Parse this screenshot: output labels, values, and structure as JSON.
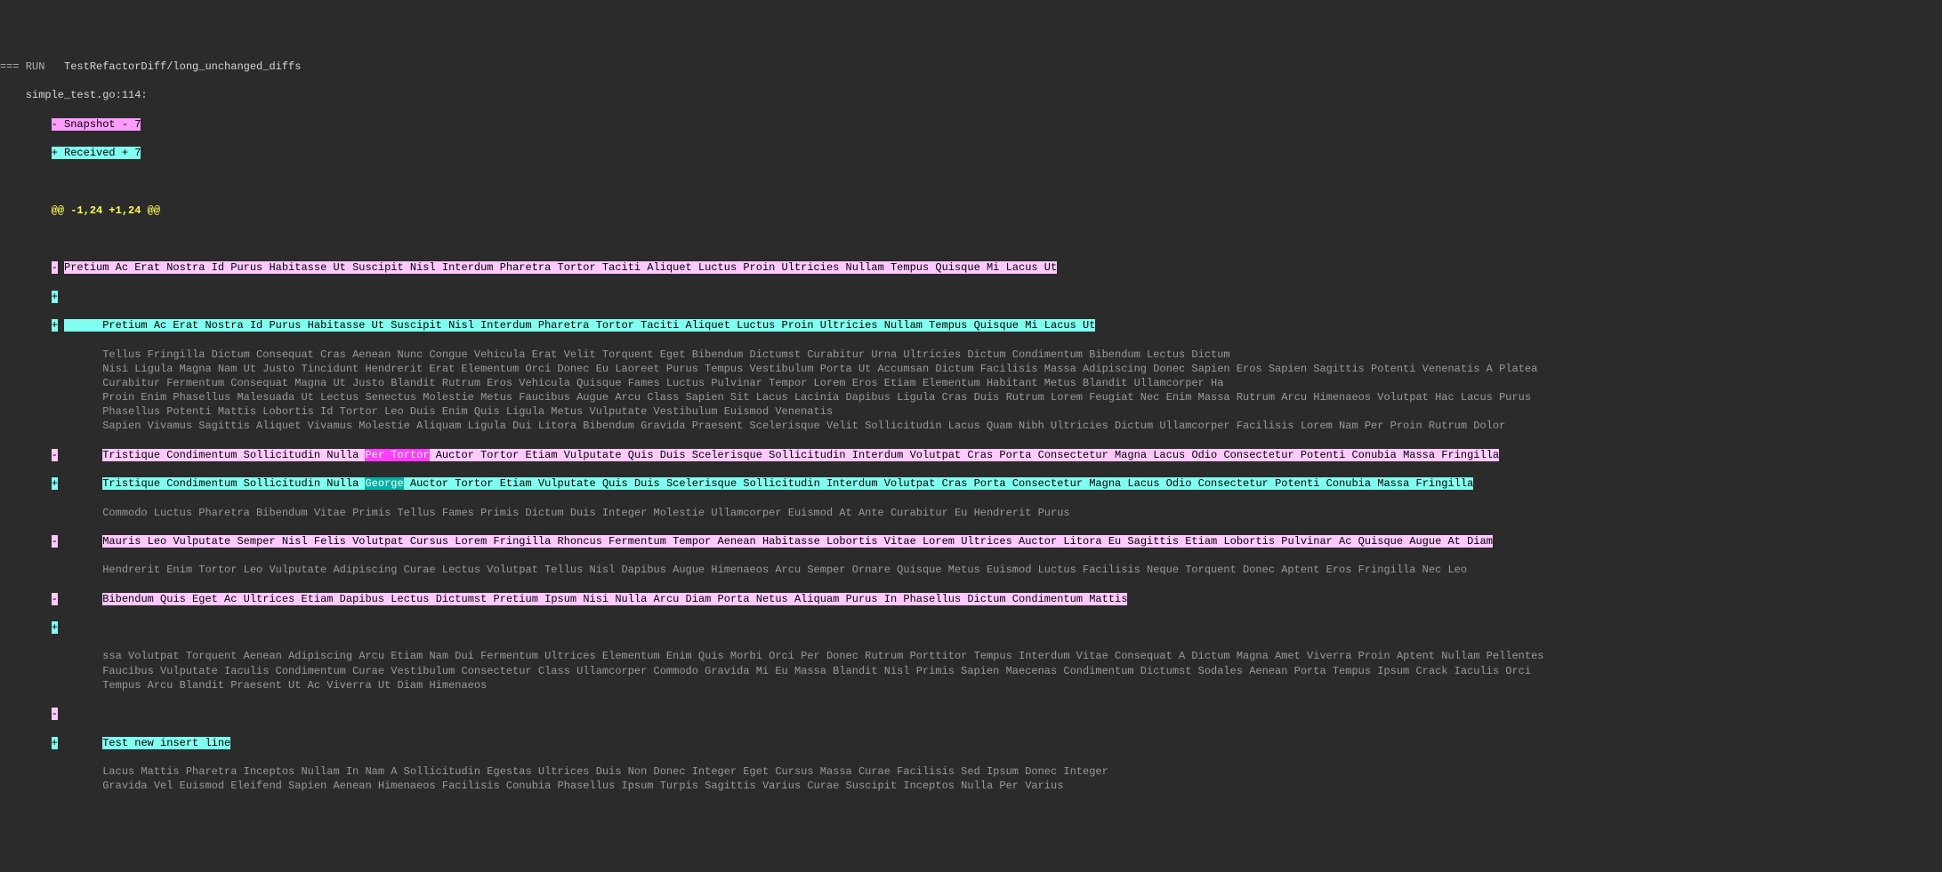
{
  "run_prefix": "=== RUN   ",
  "test_name": "TestRefactorDiff/long_unchanged_diffs",
  "file_location": "    simple_test.go:114:",
  "snapshot_line": "- Snapshot - 7",
  "received_line": "+ Received + 7",
  "hunk_header": "@@ -1,24 +1,24 @@",
  "indent_gutter": "        ",
  "indent_body": "          ",
  "del_marker": "-",
  "add_marker": "+",
  "first_del": "Pretium Ac Erat Nostra Id Purus Habitasse Ut Suscipit Nisl Interdum Pharetra Tortor Taciti Aliquet Luctus Proin Ultricies Nullam Tempus Quisque Mi Lacus Ut",
  "first_add_indent": "      Pretium Ac Erat Nostra Id Purus Habitasse Ut Suscipit Nisl Interdum Pharetra Tortor Taciti Aliquet Luctus Proin Ultricies Nullam Tempus Quisque Mi Lacus Ut",
  "ctx_block1": [
    "Tellus Fringilla Dictum Consequat Cras Aenean Nunc Congue Vehicula Erat Velit Torquent Eget Bibendum Dictumst Curabitur Urna Ultricies Dictum Condimentum Bibendum Lectus Dictum",
    "Nisi Ligula Magna Nam Ut Justo Tincidunt Hendrerit Erat Elementum Orci Donec Eu Laoreet Purus Tempus Vestibulum Porta Ut Accumsan Dictum Facilisis Massa Adipiscing Donec Sapien Eros Sapien Sagittis Potenti Venenatis A Platea",
    "Curabitur Fermentum Consequat Magna Ut Justo Blandit Rutrum Eros Vehicula Quisque Fames Luctus Pulvinar Tempor Lorem Eros Etiam Elementum Habitant Metus Blandit Ullamcorper Ha",
    "Proin Enim Phasellus Malesuada Ut Lectus Senectus Molestie Metus Faucibus Augue Arcu Class Sapien Sit Lacus Lacinia Dapibus Ligula Cras Duis Rutrum Lorem Feugiat Nec Enim Massa Rutrum Arcu Himenaeos Volutpat Hac Lacus Purus",
    "Phasellus Potenti Mattis Lobortis Id Tortor Leo Duis Enim Quis Ligula Metus Vulputate Vestibulum Euismod Venenatis",
    "Sapien Vivamus Sagittis Aliquet Vivamus Molestie Aliquam Ligula Dui Litora Bibendum Gravida Praesent Scelerisque Velit Sollicitudin Lacus Quam Nibh Ultricies Dictum Ullamcorper Facilisis Lorem Nam Per Proin Rutrum Dolor"
  ],
  "pair_del_pre": "Tristique Condimentum Sollicitudin Nulla ",
  "pair_del_word": "Per Tortor",
  "pair_del_post": " Auctor Tortor Etiam Vulputate Quis Duis Scelerisque Sollicitudin Interdum Volutpat Cras Porta Consectetur Magna Lacus Odio Consectetur Potenti Conubia Massa Fringilla",
  "pair_add_pre": "Tristique Condimentum Sollicitudin Nulla ",
  "pair_add_word": "George",
  "pair_add_post": " Auctor Tortor Etiam Vulputate Quis Duis Scelerisque Sollicitudin Interdum Volutpat Cras Porta Consectetur Magna Lacus Odio Consectetur Potenti Conubia Massa Fringilla",
  "ctx_block2": [
    "Commodo Luctus Pharetra Bibendum Vitae Primis Tellus Fames Primis Dictum Duis Integer Molestie Ullamcorper Euismod At Ante Curabitur Eu Hendrerit Purus"
  ],
  "del_mauris": "Mauris Leo Vulputate Semper Nisl Felis Volutpat Cursus Lorem Fringilla Rhoncus Fermentum Tempor Aenean Habitasse Lobortis Vitae Lorem Ultrices Auctor Litora Eu Sagittis Etiam Lobortis Pulvinar Ac Quisque Augue At Diam",
  "ctx_block3": [
    "Hendrerit Enim Tortor Leo Vulputate Adipiscing Curae Lectus Volutpat Tellus Nisl Dapibus Augue Himenaeos Arcu Semper Ornare Quisque Metus Euismod Luctus Facilisis Neque Torquent Donec Aptent Eros Fringilla Nec Leo"
  ],
  "del_bibendum": "Bibendum Quis Eget Ac Ultrices Etiam Dapibus Lectus Dictumst Pretium Ipsum Nisi Nulla Arcu Diam Porta Netus Aliquam Purus In Phasellus Dictum Condimentum Mattis",
  "ctx_block4": [
    "ssa Volutpat Torquent Aenean Adipiscing Arcu Etiam Nam Dui Fermentum Ultrices Elementum Enim Quis Morbi Orci Per Donec Rutrum Porttitor Tempus Interdum Vitae Consequat A Dictum Magna Amet Viverra Proin Aptent Nullam Pellentes",
    "Faucibus Vulputate Iaculis Condimentum Curae Vestibulum Consectetur Class Ullamcorper Commodo Gravida Mi Eu Massa Blandit Nisl Primis Sapien Maecenas Condimentum Dictumst Sodales Aenean Porta Tempus Ipsum Crack Iaculis Orci",
    "Tempus Arcu Blandit Praesent Ut Ac Viverra Ut Diam Himenaeos"
  ],
  "new_insert": "Test new insert line",
  "ctx_block5": [
    "Lacus Mattis Pharetra Inceptos Nullam In Nam A Sollicitudin Egestas Ultrices Duis Non Donec Integer Eget Cursus Massa Curae Facilisis Sed Ipsum Donec Integer",
    "Gravida Vel Euismod Eleifend Sapien Aenean Himenaeos Facilisis Conubia Phasellus Ipsum Turpis Sagittis Varius Curae Suscipit Inceptos Nulla Per Varius"
  ]
}
